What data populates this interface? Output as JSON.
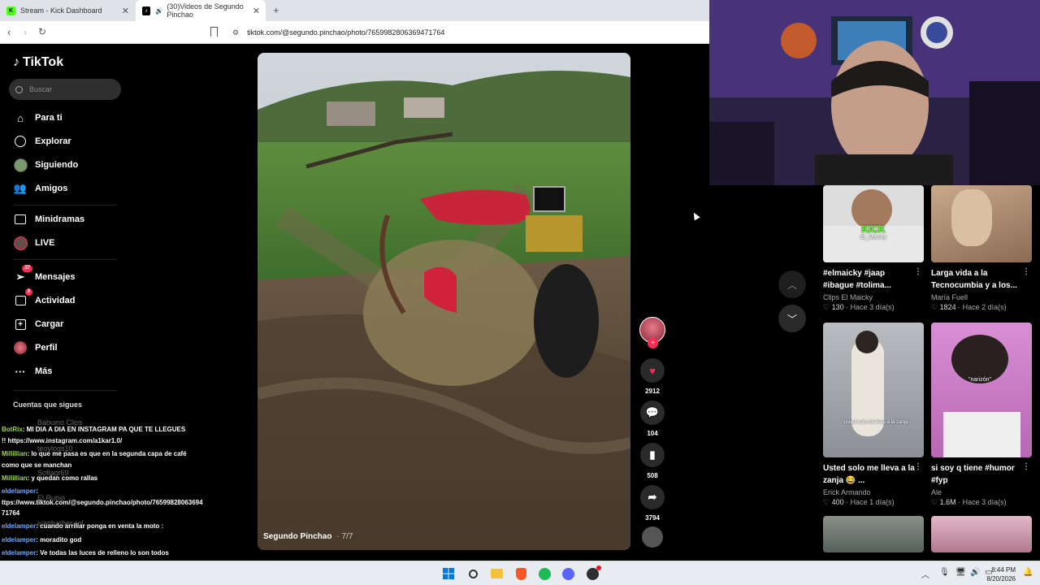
{
  "browser": {
    "tabs": [
      {
        "title": "Stream - Kick Dashboard"
      },
      {
        "title": "(30)Videos de Segundo Pinchao"
      }
    ],
    "url": "tiktok.com/@segundo.pinchao/photo/7659982806369471764"
  },
  "sidebar": {
    "brand": "TikTok",
    "search_placeholder": "Buscar",
    "items": [
      {
        "label": "Para ti",
        "icon": "home-icon"
      },
      {
        "label": "Explorar",
        "icon": "compass-icon"
      },
      {
        "label": "Siguiendo",
        "icon": "following-avatar-icon"
      },
      {
        "label": "Amigos",
        "icon": "friends-icon"
      },
      {
        "label": "Minidramas",
        "icon": "film-icon"
      },
      {
        "label": "LIVE",
        "icon": "live-icon"
      },
      {
        "label": "Mensajes",
        "icon": "messages-icon",
        "badge": "27"
      },
      {
        "label": "Actividad",
        "icon": "activity-icon",
        "badge": "3"
      },
      {
        "label": "Cargar",
        "icon": "upload-icon"
      },
      {
        "label": "Perfil",
        "icon": "profile-icon"
      },
      {
        "label": "Más",
        "icon": "more-icon"
      }
    ],
    "following_title": "Cuentas que sigues",
    "following_accounts": [
      "Babuino Clips",
      "teoylogs10",
      "Sofiagr69",
      "El Rubio",
      "juanbarber.col"
    ]
  },
  "chat": [
    {
      "user": "BotRix",
      "text": ": MI DIA A DIA EN INSTAGRAM PA QUE TE LLEGUES"
    },
    {
      "user": "",
      "text": "!! https://www.instagram.com/a1kar1.0/"
    },
    {
      "user": "Millillian",
      "text": ": lo que me pasa es que en la segunda capa de café"
    },
    {
      "user": "",
      "text": "como que se manchan"
    },
    {
      "user": "Millillian",
      "text": ": y quedan como rallas"
    },
    {
      "user": "eldelamper",
      "text": ":"
    },
    {
      "user": "",
      "text": "ttps://www.tiktok.com/@segundo.pinchao/photo/76599828063694"
    },
    {
      "user": "",
      "text": "71764"
    },
    {
      "user": "eldelamper",
      "text": ": cuando arriliar ponga en venta la moto :"
    },
    {
      "user": "eldelamper",
      "text": ": moradito god"
    },
    {
      "user": "eldelamper",
      "text": ": Ve todas las luces de relleno lo son todos"
    }
  ],
  "post": {
    "author": "Segundo Pinchao",
    "photo_count": "· 7/7",
    "likes": "2912",
    "comments": "104",
    "saves": "508",
    "shares": "3794"
  },
  "related": [
    {
      "caption": "#elmaicky #jaap #ibague #tolima...",
      "author": "Clips El Maicky",
      "likes": "130",
      "age": "Hace 3 día(s)",
      "thumb_text": "KICK",
      "thumb_sub": "El_Maicky"
    },
    {
      "caption": "Larga vida a la Tecnocumbia y a los...",
      "author": "María Fuell",
      "likes": "1824",
      "age": "Hace 2 día(s)",
      "thumb_text": "",
      "thumb_sub": ""
    },
    {
      "caption": "Usted solo me lleva a la zanja 😂 ...",
      "author": "Erick Armando",
      "likes": "400",
      "age": "Hace 1 día(s)",
      "thumb_text": "usted solo me lleva a la zanja",
      "thumb_sub": ""
    },
    {
      "caption": "si soy q tiene #humor #fyp",
      "author": "Ale",
      "likes": "1.6M",
      "age": "Hace 3 día(s)",
      "thumb_text": "\"narizón\"",
      "thumb_sub": ""
    }
  ],
  "taskbar": {
    "time": "8:44 PM",
    "date": "8/20/2026"
  },
  "colors": {
    "accent": "#fe2c55",
    "background": "#000000",
    "chat_user": "#9fd35a"
  }
}
